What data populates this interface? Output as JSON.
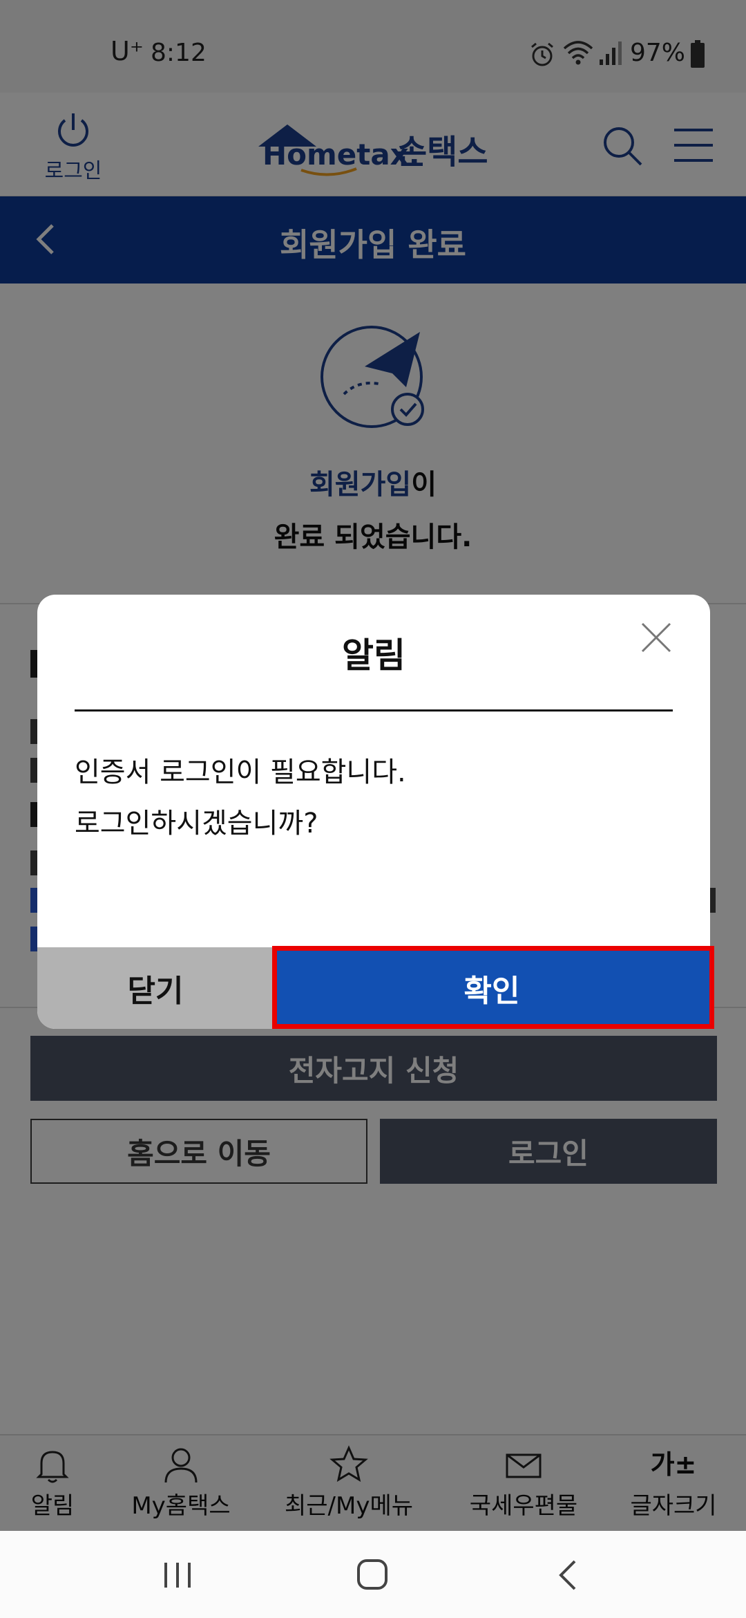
{
  "status_bar": {
    "carrier": "U⁺",
    "time": "8:12",
    "battery": "97%"
  },
  "header": {
    "login_label": "로그인",
    "logo_text": "Hometax.",
    "logo_text_ko": "손택스"
  },
  "title_bar": {
    "title": "회원가입 완료"
  },
  "main": {
    "done_highlight": "회원가입",
    "done_suffix": "이",
    "done_line2": "완료 되었습니다.",
    "enotice_button": "전자고지 신청",
    "home_button": "홈으로 이동",
    "login_button": "로그인"
  },
  "tabs": [
    {
      "label": "알림",
      "icon": "bell-icon"
    },
    {
      "label": "My홈택스",
      "icon": "person-icon"
    },
    {
      "label": "최근/My메뉴",
      "icon": "star-icon"
    },
    {
      "label": "국세우편물",
      "icon": "mail-icon"
    },
    {
      "label": "글자크기",
      "icon": "font-size-icon",
      "glyph": "가±"
    }
  ],
  "dialog": {
    "title": "알림",
    "message_line1": "인증서 로그인이 필요합니다.",
    "message_line2": "로그인하시겠습니까?",
    "cancel_label": "닫기",
    "confirm_label": "확인"
  },
  "colors": {
    "brand_blue": "#0c3a99",
    "confirm_blue": "#1250b2",
    "highlight_red": "#ea0000",
    "cancel_gray": "#b2b2b2"
  }
}
